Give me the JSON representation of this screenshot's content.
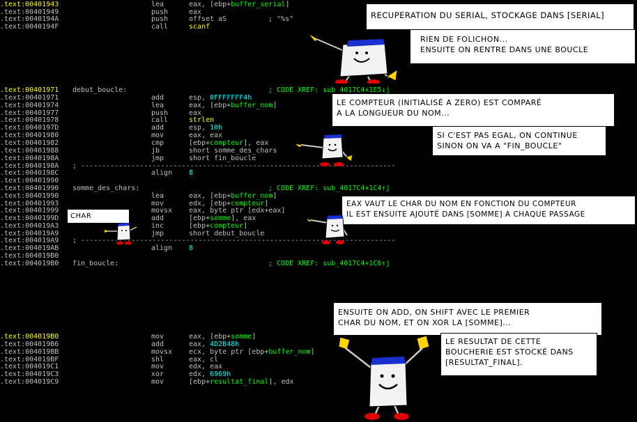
{
  "disasm": [
    {
      "addr": ".text:00401943",
      "hl": true,
      "label": "",
      "mn": "lea",
      "op": [
        [
          "eax, [ebp+",
          ""
        ],
        [
          "buffer_serial",
          "green"
        ],
        [
          "]",
          ""
        ]
      ],
      "cm": ""
    },
    {
      "addr": ".text:00401949",
      "hl": false,
      "label": "",
      "mn": "push",
      "op": [
        [
          "eax",
          ""
        ]
      ],
      "cm": ""
    },
    {
      "addr": ".text:0040194A",
      "hl": false,
      "label": "",
      "mn": "push",
      "op": [
        [
          "offset aS",
          ""
        ]
      ],
      "cm": "; \"%s\"",
      "cmc": "#c0c0c0"
    },
    {
      "addr": ".text:0040194F",
      "hl": false,
      "label": "",
      "mn": "call",
      "op": [
        [
          "scanf",
          "yellow"
        ]
      ],
      "cm": ""
    },
    {
      "addr": ".text:00401971",
      "hl": true,
      "label": "debut_boucle:",
      "mn": "",
      "op": [],
      "cm": "; CODE XREF: sub_4017C4+1E5↓j"
    },
    {
      "addr": ".text:00401971",
      "hl": false,
      "label": "",
      "mn": "add",
      "op": [
        [
          "esp, ",
          ""
        ],
        [
          "0FFFFFFF4h",
          "cyan"
        ]
      ],
      "cm": ""
    },
    {
      "addr": ".text:00401974",
      "hl": false,
      "label": "",
      "mn": "lea",
      "op": [
        [
          "eax, [ebp+",
          ""
        ],
        [
          "buffer_nom",
          "green"
        ],
        [
          "]",
          ""
        ]
      ],
      "cm": ""
    },
    {
      "addr": ".text:00401977",
      "hl": false,
      "label": "",
      "mn": "push",
      "op": [
        [
          "eax",
          ""
        ]
      ],
      "cm": ""
    },
    {
      "addr": ".text:00401978",
      "hl": false,
      "label": "",
      "mn": "call",
      "op": [
        [
          "strlen",
          "yellow"
        ]
      ],
      "cm": ""
    },
    {
      "addr": ".text:0040197D",
      "hl": false,
      "label": "",
      "mn": "add",
      "op": [
        [
          "esp, ",
          ""
        ],
        [
          "10h",
          "cyan"
        ]
      ],
      "cm": ""
    },
    {
      "addr": ".text:00401980",
      "hl": false,
      "label": "",
      "mn": "mov",
      "op": [
        [
          "eax, eax",
          ""
        ]
      ],
      "cm": ""
    },
    {
      "addr": ".text:00401982",
      "hl": false,
      "label": "",
      "mn": "cmp",
      "op": [
        [
          "[ebp+",
          ""
        ],
        [
          "compteur",
          "green"
        ],
        [
          "], eax",
          ""
        ]
      ],
      "cm": ""
    },
    {
      "addr": ".text:00401988",
      "hl": false,
      "label": "",
      "mn": "jb",
      "op": [
        [
          "short somme_des_chars",
          ""
        ]
      ],
      "cm": ""
    },
    {
      "addr": ".text:0040198A",
      "hl": false,
      "label": "",
      "mn": "jmp",
      "op": [
        [
          "short fin_boucle",
          ""
        ]
      ],
      "cm": ""
    },
    {
      "addr": ".text:0040198A",
      "hl": false,
      "dash": true
    },
    {
      "addr": ".text:0040198C",
      "hl": false,
      "label": "",
      "mn": "align",
      "op": [
        [
          "8",
          "cyan"
        ]
      ],
      "cm": ""
    },
    {
      "addr": ".text:00401990",
      "hl": false,
      "label": "",
      "mn": "",
      "op": [],
      "cm": ""
    },
    {
      "addr": ".text:00401990",
      "hl": false,
      "label": "somme_des_chars:",
      "mn": "",
      "op": [],
      "cm": "; CODE XREF: sub_4017C4+1C4↑j"
    },
    {
      "addr": ".text:00401990",
      "hl": false,
      "label": "",
      "mn": "lea",
      "op": [
        [
          "eax, [ebp+",
          ""
        ],
        [
          "buffer_nom",
          "green"
        ],
        [
          "]",
          ""
        ]
      ],
      "cm": ""
    },
    {
      "addr": ".text:00401993",
      "hl": false,
      "label": "",
      "mn": "mov",
      "op": [
        [
          "edx, [ebp+",
          ""
        ],
        [
          "compteur",
          "green"
        ],
        [
          "]",
          ""
        ]
      ],
      "cm": ""
    },
    {
      "addr": ".text:00401999",
      "hl": false,
      "label": "",
      "mn": "movsx",
      "op": [
        [
          "eax, byte ptr [edx+eax]",
          ""
        ]
      ],
      "cm": ""
    },
    {
      "addr": ".text:0040199D",
      "hl": false,
      "label": "",
      "mn": "add",
      "op": [
        [
          "[ebp+",
          ""
        ],
        [
          "somme",
          "green"
        ],
        [
          "], eax",
          ""
        ]
      ],
      "cm": ""
    },
    {
      "addr": ".text:004019A3",
      "hl": false,
      "label": "",
      "mn": "inc",
      "op": [
        [
          "[ebp+",
          ""
        ],
        [
          "compteur",
          "green"
        ],
        [
          "]",
          ""
        ]
      ],
      "cm": ""
    },
    {
      "addr": ".text:004019A9",
      "hl": false,
      "label": "",
      "mn": "jmp",
      "op": [
        [
          "short debut_boucle",
          ""
        ]
      ],
      "cm": ""
    },
    {
      "addr": ".text:004019A9",
      "hl": false,
      "dash": true
    },
    {
      "addr": ".text:004019AB",
      "hl": false,
      "label": "",
      "mn": "align",
      "op": [
        [
          "8",
          "cyan"
        ]
      ],
      "cm": ""
    },
    {
      "addr": ".text:004019B0",
      "hl": false,
      "label": "",
      "mn": "",
      "op": [],
      "cm": ""
    },
    {
      "addr": ".text:004019B0",
      "hl": false,
      "label": "fin_boucle:",
      "mn": "",
      "op": [],
      "cm": "; CODE XREF: sub_4017C4+1C6↑j"
    },
    {
      "addr": ".text:004019B0",
      "hl": true,
      "label": "",
      "mn": "mov",
      "op": [
        [
          "eax, [ebp+",
          ""
        ],
        [
          "somme",
          "green"
        ],
        [
          "]",
          ""
        ]
      ],
      "cm": ""
    },
    {
      "addr": ".text:004019B6",
      "hl": false,
      "label": "",
      "mn": "add",
      "op": [
        [
          "eax, ",
          ""
        ],
        [
          "4D2B48h",
          "cyan"
        ]
      ],
      "cm": ""
    },
    {
      "addr": ".text:004019BB",
      "hl": false,
      "label": "",
      "mn": "movsx",
      "op": [
        [
          "ecx, byte ptr [ebp+",
          ""
        ],
        [
          "buffer_nom",
          "green"
        ],
        [
          "]",
          ""
        ]
      ],
      "cm": ""
    },
    {
      "addr": ".text:004019BF",
      "hl": false,
      "label": "",
      "mn": "shl",
      "op": [
        [
          "eax, cl",
          ""
        ]
      ],
      "cm": ""
    },
    {
      "addr": ".text:004019C1",
      "hl": false,
      "label": "",
      "mn": "mov",
      "op": [
        [
          "edx, eax",
          ""
        ]
      ],
      "cm": ""
    },
    {
      "addr": ".text:004019C3",
      "hl": false,
      "label": "",
      "mn": "xor",
      "op": [
        [
          "edx, ",
          ""
        ],
        [
          "6969h",
          "cyan"
        ]
      ],
      "cm": ""
    },
    {
      "addr": ".text:004019C9",
      "hl": false,
      "label": "",
      "mn": "mov",
      "op": [
        [
          "[ebp+",
          ""
        ],
        [
          "resultat_final",
          "green"
        ],
        [
          "], edx",
          ""
        ]
      ],
      "cm": ""
    }
  ],
  "dash_text": "; ---------------------------------------------------------------------------",
  "bubbles": {
    "b1": "RECUPERATION DU SERIAL, STOCKAGE DANS [SERIAL]",
    "b2": "RIEN DE FOLICHON...\nENSUITE ON RENTRE DANS UNE BOUCLE",
    "b3": "LE COMPTEUR (INITIALISÉ A ZERO) EST COMPARÉ\nA LA LONGUEUR DU NOM...",
    "b4": "SI C'EST PAS EGAL, ON CONTINUE\nSINON ON VA A \"FIN_BOUCLE\"",
    "b5": "EAX VAUT LE CHAR DU NOM EN FONCTION DU COMPTEUR\nIL EST ENSUITE AJOUTÉ DANS [SOMME] A CHAQUE PASSAGE",
    "b6": "CHAR SUIVANT",
    "b7": "ENSUITE ON ADD, ON SHIFT AVEC LE PREMIER\nCHAR DU NOM, ET ON XOR LA [SOMME]...",
    "b8": "LE RESULTAT DE CETTE\nBOUCHERIE EST STOCKÉ DANS\n[RESULTAT_FINAL]."
  },
  "colors": {
    "bg": "#000000",
    "text": "#c0c0c0",
    "address_highlight": "#ffff00",
    "name": "#00ff00",
    "number": "#00ffff",
    "function": "#ffff00"
  }
}
